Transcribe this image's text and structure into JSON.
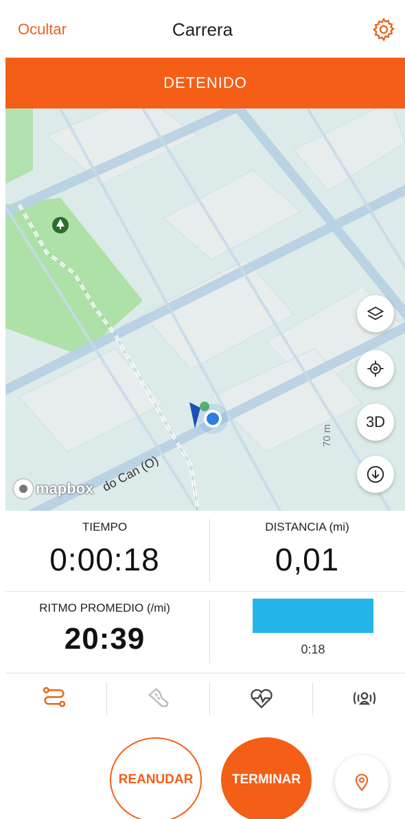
{
  "header": {
    "hide_label": "Ocultar",
    "title": "Carrera",
    "settings_icon": "gear-icon"
  },
  "status": {
    "label": "DETENIDO",
    "color": "#f45e17"
  },
  "map": {
    "attribution": "mapbox",
    "street_label": "do Can (O)",
    "elevation_label": "70 m",
    "controls": [
      {
        "icon": "layers-icon"
      },
      {
        "icon": "locate-icon"
      },
      {
        "label": "3D"
      },
      {
        "icon": "download-icon"
      }
    ]
  },
  "stats": {
    "time": {
      "label": "TIEMPO",
      "value": "0:00:18"
    },
    "distance": {
      "label": "DISTANCIA (mi)",
      "value": "0,01"
    },
    "pace": {
      "label": "RITMO PROMEDIO (/mi)",
      "value": "20:39"
    },
    "split": {
      "time": "0:18",
      "color": "#23b5ea"
    }
  },
  "tabs": [
    {
      "icon": "route-icon",
      "active": true
    },
    {
      "icon": "shoe-icon",
      "active": false
    },
    {
      "icon": "heart-rate-icon",
      "active": false
    },
    {
      "icon": "sensor-icon",
      "active": false
    }
  ],
  "actions": {
    "resume_label": "REANUDAR",
    "finish_label": "TERMINAR",
    "pin_icon": "map-pin-icon"
  },
  "colors": {
    "accent": "#f45e17",
    "blue": "#23b5ea"
  }
}
